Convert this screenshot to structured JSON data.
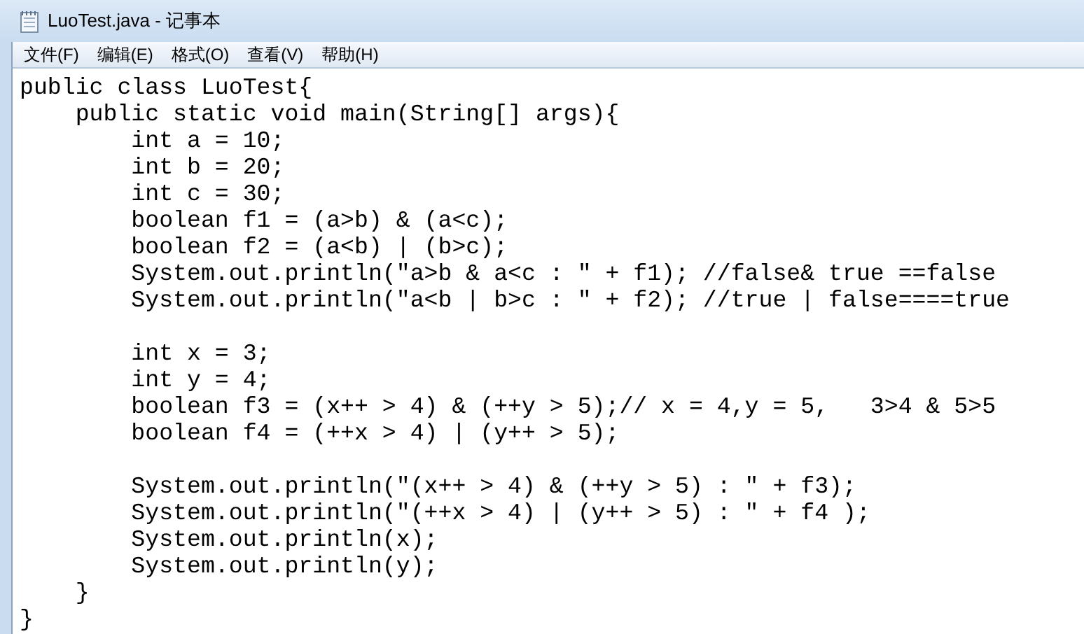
{
  "window": {
    "title": "LuoTest.java - 记事本"
  },
  "menu": [
    "文件(F)",
    "编辑(E)",
    "格式(O)",
    "查看(V)",
    "帮助(H)"
  ],
  "editor": {
    "lines": [
      {
        "kind": "code",
        "text": "public class LuoTest{"
      },
      {
        "kind": "code",
        "text": "    public static void main(String[] args){"
      },
      {
        "kind": "code",
        "text": "        int a = 10;"
      },
      {
        "kind": "code",
        "text": "        int b = 20;"
      },
      {
        "kind": "code",
        "text": "        int c = 30;"
      },
      {
        "kind": "code",
        "text": "        boolean f1 = (a>b) & (a<c);"
      },
      {
        "kind": "code",
        "text": "        boolean f2 = (a<b) | (b>c);"
      },
      {
        "kind": "code",
        "text": "        System.out.println(\"a>b & a<c : \" + f1); //false& true ==false"
      },
      {
        "kind": "code",
        "text": "        System.out.println(\"a<b | b>c : \" + f2); //true | false====true"
      },
      {
        "kind": "blank"
      },
      {
        "kind": "code",
        "text": "        int x = 3;"
      },
      {
        "kind": "code",
        "text": "        int y = 4;"
      },
      {
        "kind": "code",
        "text": "        boolean f3 = (x++ > 4) & (++y > 5);// x = 4,y = 5,   3>4 & 5>5"
      },
      {
        "kind": "code",
        "text": "        boolean f4 = (++x > 4) | (y++ > 5);"
      },
      {
        "kind": "blank"
      },
      {
        "kind": "code",
        "text": "        System.out.println(\"(x++ > 4) & (++y > 5) : \" + f3);"
      },
      {
        "kind": "code",
        "text": "        System.out.println(\"(++x > 4) | (y++ > 5) : \" + f4 );"
      },
      {
        "kind": "code",
        "text": "        System.out.println(x);"
      },
      {
        "kind": "code",
        "text": "        System.out.println(y);"
      },
      {
        "kind": "code",
        "text": "    }"
      },
      {
        "kind": "code",
        "text": "}"
      }
    ]
  }
}
